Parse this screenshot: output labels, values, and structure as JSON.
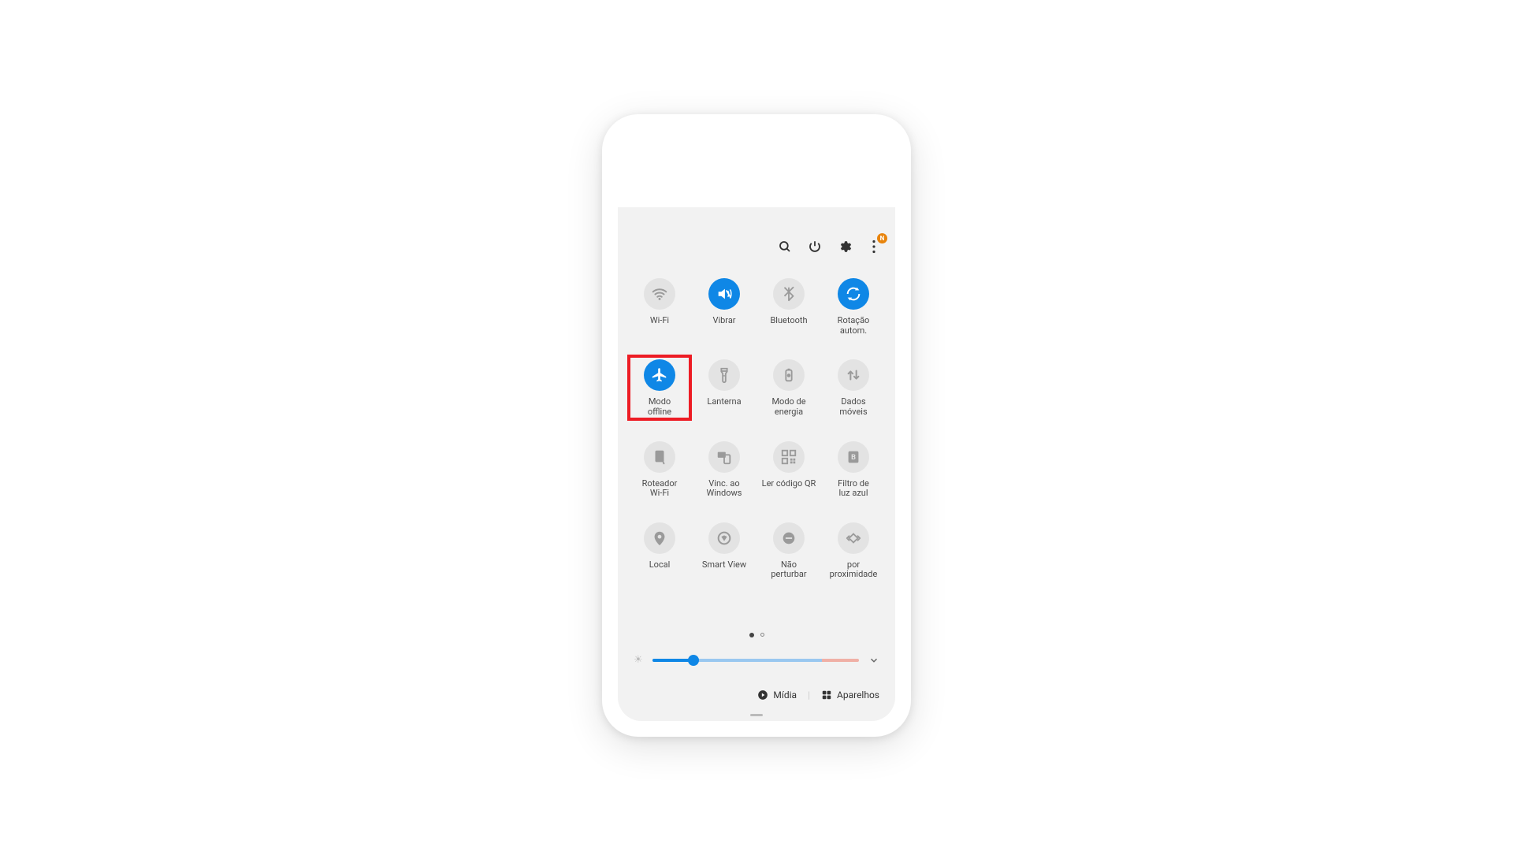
{
  "colors": {
    "accent": "#0f87e6",
    "tileInactive": "#e3e3e3",
    "highlight": "#ed1c24",
    "badge": "#e8840c"
  },
  "header": {
    "icons": {
      "search": "search",
      "power": "power",
      "settings": "gear",
      "more": "more-vertical"
    },
    "moreBadge": "N"
  },
  "tiles": [
    {
      "id": "wifi",
      "label": "Wi-Fi",
      "active": false,
      "icon": "wifi"
    },
    {
      "id": "vibrar",
      "label": "Vibrar",
      "active": true,
      "icon": "volume-vibrate"
    },
    {
      "id": "bluetooth",
      "label": "Bluetooth",
      "active": false,
      "icon": "bluetooth"
    },
    {
      "id": "rotacao",
      "label": "Rotação\nautom.",
      "active": true,
      "icon": "rotate"
    },
    {
      "id": "modo-offline",
      "label": "Modo\noffline",
      "active": true,
      "icon": "airplane",
      "highlighted": true
    },
    {
      "id": "lanterna",
      "label": "Lanterna",
      "active": false,
      "icon": "flashlight"
    },
    {
      "id": "modo-energia",
      "label": "Modo de\nenergia",
      "active": false,
      "icon": "battery-power"
    },
    {
      "id": "dados-moveis",
      "label": "Dados\nmóveis",
      "active": false,
      "icon": "data-arrows"
    },
    {
      "id": "roteador",
      "label": "Roteador\nWi-Fi",
      "active": false,
      "icon": "hotspot"
    },
    {
      "id": "vinc-windows",
      "label": "Vinc. ao\nWindows",
      "active": false,
      "icon": "link-windows"
    },
    {
      "id": "ler-qr",
      "label": "Ler código QR",
      "active": false,
      "icon": "qr"
    },
    {
      "id": "filtro-luz",
      "label": "Filtro de\nluz azul",
      "active": false,
      "icon": "bluelight"
    },
    {
      "id": "local",
      "label": "Local",
      "active": false,
      "icon": "location"
    },
    {
      "id": "smart-view",
      "label": "Smart View",
      "active": false,
      "icon": "smart-view"
    },
    {
      "id": "nao-perturbar",
      "label": "Não\nperturbar",
      "active": false,
      "icon": "dnd"
    },
    {
      "id": "proximidade",
      "label": "por proximidade",
      "active": false,
      "icon": "nearby"
    }
  ],
  "pager": {
    "current": 1,
    "total": 2
  },
  "brightness": {
    "value": 20
  },
  "bottom": {
    "media": "Mídia",
    "devices": "Aparelhos"
  }
}
